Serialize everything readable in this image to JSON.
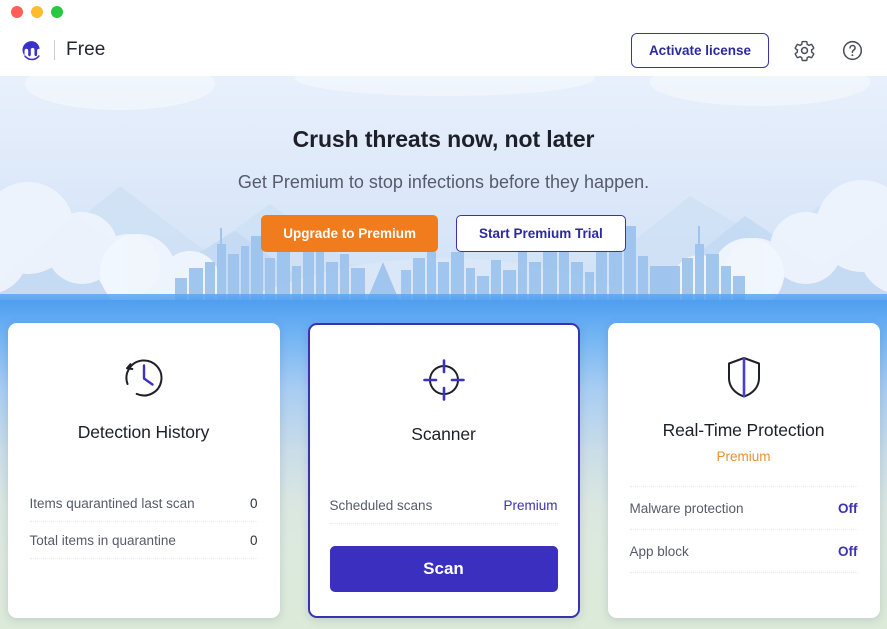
{
  "window": {
    "traffic_lights": [
      "close",
      "minimize",
      "maximize"
    ]
  },
  "header": {
    "brand_name": "Free",
    "logo_icon": "malwarebytes-logo-icon",
    "activate_label": "Activate license",
    "settings_icon": "gear-icon",
    "help_icon": "question-circle-icon"
  },
  "hero": {
    "title": "Crush threats now, not later",
    "subtitle": "Get Premium to stop infections before they happen.",
    "upgrade_label": "Upgrade to Premium",
    "trial_label": "Start Premium Trial"
  },
  "cards": {
    "detection_history": {
      "icon": "clock-history-icon",
      "title": "Detection History",
      "rows": [
        {
          "label": "Items quarantined last scan",
          "value": "0"
        },
        {
          "label": "Total items in quarantine",
          "value": "0"
        }
      ]
    },
    "scanner": {
      "icon": "crosshair-scanner-icon",
      "title": "Scanner",
      "rows": [
        {
          "label": "Scheduled scans",
          "value": "Premium"
        }
      ],
      "scan_label": "Scan"
    },
    "realtime_protection": {
      "icon": "shield-icon",
      "title": "Real-Time Protection",
      "premium_tag": "Premium",
      "rows": [
        {
          "label": "Malware protection",
          "value": "Off"
        },
        {
          "label": "App block",
          "value": "Off"
        }
      ]
    }
  },
  "colors": {
    "brand_purple": "#3a33b0",
    "scan_button": "#3a2fbf",
    "upgrade_orange": "#f07c1e",
    "premium_orange": "#f0902a",
    "text_dark": "#1e2029",
    "text_muted": "#565b6b"
  }
}
